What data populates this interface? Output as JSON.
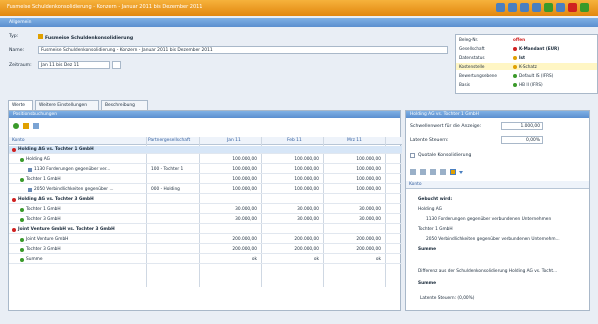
{
  "window": {
    "title": "Fusmeise Schuldenkonsolidierung - Konzern - Januar 2011 bis Dezember 2011"
  },
  "section": {
    "label": "Allgemein"
  },
  "form": {
    "typ_label": "Typ:",
    "typ_value": "Fusmeise Schuldenkonsolidierung",
    "name_label": "Name:",
    "name_value": "Fusmeise Schuldenkonsolidierung - Konzern - Januar 2011 bis Dezember 2011",
    "zeitraum_label": "Zeitraum:",
    "zeitraum_value": "Jan 11 bis Dez 11"
  },
  "info": [
    {
      "k": "Beleg-Nr.",
      "v": "offen",
      "color": "#d02020"
    },
    {
      "k": "Gesellschaft",
      "v": "K-Mandant (EUR)",
      "color": "#d02020"
    },
    {
      "k": "Datenstatus",
      "v": "Ist",
      "color": "#e0a000"
    },
    {
      "k": "Kostenstelle",
      "v": "K-Schatz",
      "color": "#e0a000"
    },
    {
      "k": "Bewertungsebene",
      "v": "Default IS (IFRS)",
      "color": "#3a9a2a"
    },
    {
      "k": "Basis",
      "v": "HB II (IFRS)",
      "color": "#3a9a2a"
    }
  ],
  "tabs": [
    "Werte",
    "Weitere Einstellungen",
    "Beschreibung"
  ],
  "main": {
    "header": "Positionsbuchungen",
    "columns": [
      "Konto",
      "Partnergesellschaft",
      "Jan 11",
      "Feb 11",
      "Mrz 11"
    ],
    "rows": [
      {
        "label": "Holding AG vs. Tochter 1 GmbH",
        "partner": "",
        "jan": "",
        "feb": "",
        "mrz": "",
        "indent": 0
      },
      {
        "label": "Holding AG",
        "partner": "",
        "jan": "100.000,00",
        "feb": "100.000,00",
        "mrz": "100.000,00",
        "indent": 1
      },
      {
        "label": "1130 Forderungen gegenüber ver...",
        "partner": "100 - Tochter 1",
        "jan": "100.000,00",
        "feb": "100.000,00",
        "mrz": "100.000,00",
        "indent": 2
      },
      {
        "label": "Tochter 1 GmbH",
        "partner": "",
        "jan": "100.000,00",
        "feb": "100.000,00",
        "mrz": "100.000,00",
        "indent": 1
      },
      {
        "label": "2050 Verbindlichkeiten gegenüber ...",
        "partner": "000 - Holding",
        "jan": "100.000,00",
        "feb": "100.000,00",
        "mrz": "100.000,00",
        "indent": 2
      },
      {
        "label": "Holding AG vs. Tochter 3 GmbH",
        "partner": "",
        "jan": "",
        "feb": "",
        "mrz": "",
        "indent": 0
      },
      {
        "label": "Tochter 1 GmbH",
        "partner": "",
        "jan": "30.000,00",
        "feb": "30.000,00",
        "mrz": "30.000,00",
        "indent": 1
      },
      {
        "label": "Tochter 3 GmbH",
        "partner": "",
        "jan": "30.000,00",
        "feb": "30.000,00",
        "mrz": "30.000,00",
        "indent": 1
      },
      {
        "label": "Joint Venture GmbH vs. Tochter 3 GmbH",
        "partner": "",
        "jan": "",
        "feb": "",
        "mrz": "",
        "indent": 0
      },
      {
        "label": "Joint Venture GmbH",
        "partner": "",
        "jan": "200.000,00",
        "feb": "200.000,00",
        "mrz": "200.000,00",
        "indent": 1
      },
      {
        "label": "Tochter 3 GmbH",
        "partner": "",
        "jan": "200.000,00",
        "feb": "200.000,00",
        "mrz": "200.000,00",
        "indent": 1
      },
      {
        "label": "Summe",
        "partner": "",
        "jan": "ok",
        "feb": "ok",
        "mrz": "ok",
        "indent": 1
      }
    ]
  },
  "right": {
    "header": "Holding AG vs. Tochter 1 GmbH",
    "schwelle_label": "Schwellenwert für die Anzeige:",
    "schwelle_value": "1.000,00",
    "steuer_label": "Latente Steuern:",
    "steuer_value": "0,00%",
    "quotal_label": "Quotale Konsolidierung",
    "konto_header": "Konto",
    "gebucht_label": "Gebucht wird:",
    "items": [
      "Holding AG",
      "1130 Forderungen gegenüber verbundenen Unternehmen",
      "Tochter 1 GmbH",
      "2050 Verbindlichkeiten gegenüber verbundenen Unternehm...",
      "Summe",
      "Differenz aus der Schuldenkonsolidierung Holding AG vs. Tocht...",
      "Summe",
      "Latente Steuern: (0,00%)"
    ]
  }
}
